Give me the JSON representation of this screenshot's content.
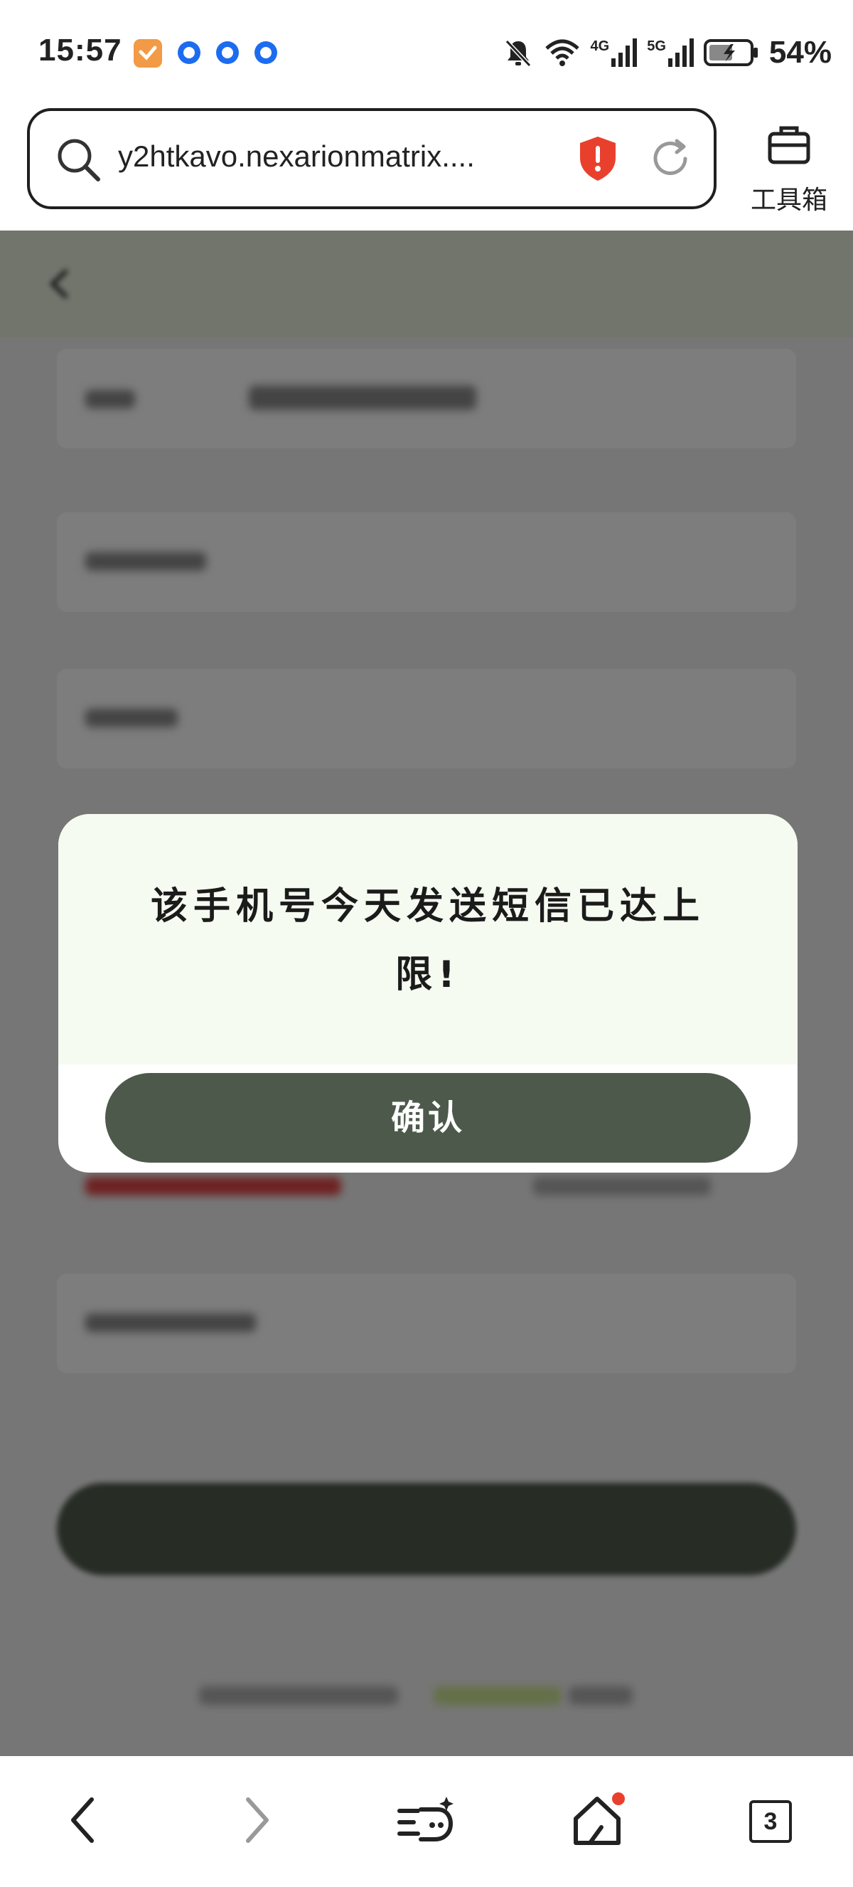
{
  "status_bar": {
    "time": "15:57",
    "battery": "54%",
    "signal_4g": "4G",
    "signal_5g": "5G"
  },
  "browser": {
    "url": "y2htkavo.nexarionmatrix....",
    "toolbox_label": "工具箱",
    "tab_count": "3"
  },
  "dialog": {
    "message": "该手机号今天发送短信已达上限!",
    "confirm_label": "确认"
  },
  "colors": {
    "dialog_bg": "#f5fbf0",
    "button": "#4d5a4b",
    "shield": "#e9402e",
    "accent_dot": "#1d6cf0"
  }
}
